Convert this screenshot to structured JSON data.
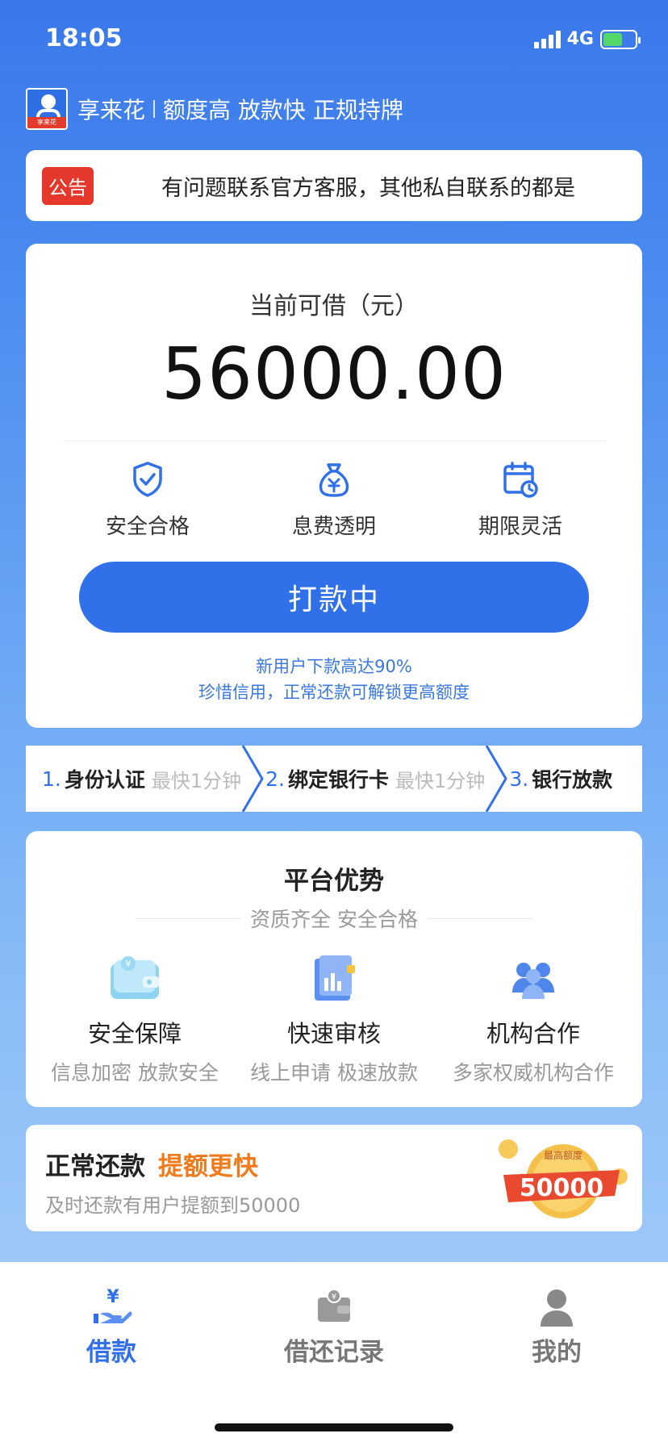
{
  "status": {
    "time": "18:05",
    "network": "4G"
  },
  "brand": {
    "name": "享来花",
    "slogan": "额度高 放款快 正规持牌",
    "logo_strip": "享来花"
  },
  "notice": {
    "badge": "公告",
    "text": "有问题联系官方客服，其他私自联系的都是"
  },
  "loan": {
    "label": "当前可借（元）",
    "amount": "56000.00",
    "features": [
      {
        "label": "安全合格",
        "icon": "shield-check-icon"
      },
      {
        "label": "息费透明",
        "icon": "money-bag-icon"
      },
      {
        "label": "期限灵活",
        "icon": "calendar-clock-icon"
      }
    ],
    "button_label": "打款中",
    "tip1": "新用户下款高达90%",
    "tip2": "珍惜信用，正常还款可解锁更高额度"
  },
  "steps": [
    {
      "num": "1.",
      "title": "身份认证",
      "hint": "最快1分钟"
    },
    {
      "num": "2.",
      "title": "绑定银行卡",
      "hint": "最快1分钟"
    },
    {
      "num": "3.",
      "title": "银行放款",
      "hint": ""
    }
  ],
  "advantages": {
    "title": "平台优势",
    "subtitle": "资质齐全 安全合格",
    "items": [
      {
        "title": "安全保障",
        "desc": "信息加密 放款安全",
        "icon": "wallet-icon"
      },
      {
        "title": "快速审核",
        "desc": "线上申请 极速放款",
        "icon": "document-chart-icon"
      },
      {
        "title": "机构合作",
        "desc": "多家权威机构合作",
        "icon": "people-group-icon"
      }
    ]
  },
  "promo": {
    "title_black": "正常还款",
    "title_orange": "提额更快",
    "desc": "及时还款有用户提额到50000",
    "medal_top": "最高额度",
    "medal_value": "50000"
  },
  "tabs": [
    {
      "label": "借款",
      "icon": "loan-hand-icon",
      "active": true
    },
    {
      "label": "借还记录",
      "icon": "wallet-record-icon",
      "active": false
    },
    {
      "label": "我的",
      "icon": "user-icon",
      "active": false
    }
  ],
  "colors": {
    "primary": "#3070e8",
    "notice_red": "#e3382b",
    "promo_orange": "#f07b1d"
  }
}
